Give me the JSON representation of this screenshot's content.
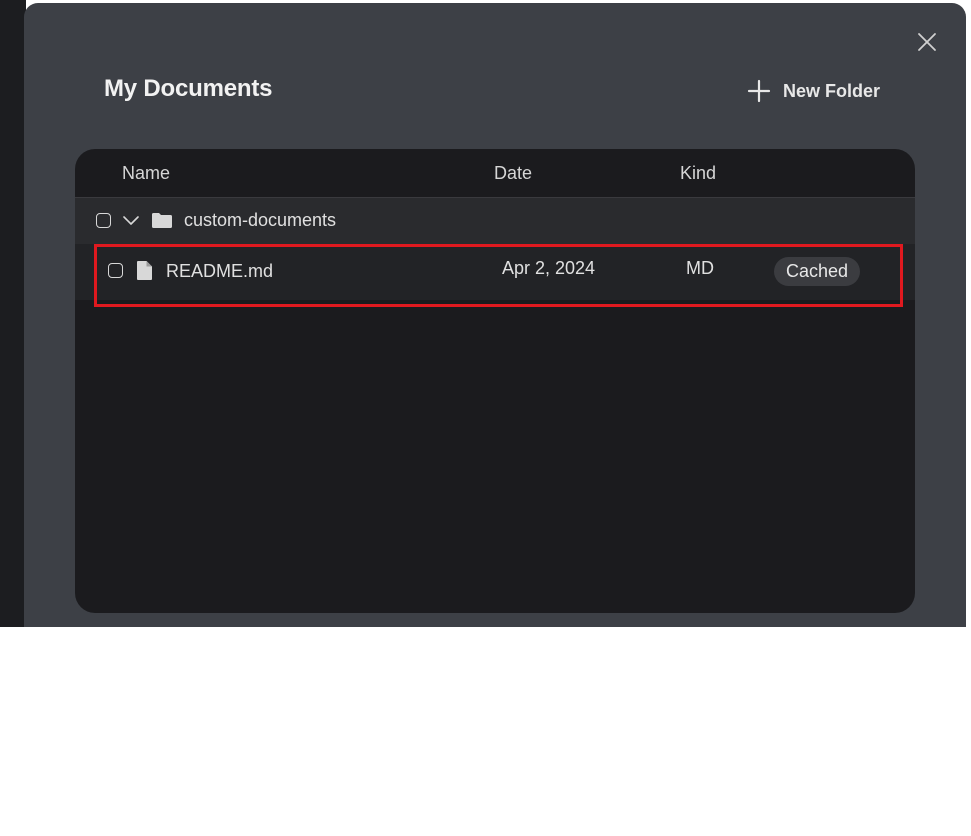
{
  "modal": {
    "title": "My Documents",
    "new_folder_label": "New Folder",
    "close_icon": "close-icon",
    "plus_icon": "plus-icon"
  },
  "table": {
    "columns": {
      "name": "Name",
      "date": "Date",
      "kind": "Kind"
    },
    "folder": {
      "name": "custom-documents",
      "icon": "folder-icon",
      "expand_icon": "chevron-down-icon",
      "expanded": true
    },
    "files": [
      {
        "name": "README.md",
        "date": "Apr 2, 2024",
        "kind": "MD",
        "status": "Cached",
        "icon": "file-icon"
      }
    ]
  },
  "colors": {
    "modal_bg": "#3d4046",
    "panel_bg": "#1b1b1e",
    "highlight": "#e0191f"
  }
}
